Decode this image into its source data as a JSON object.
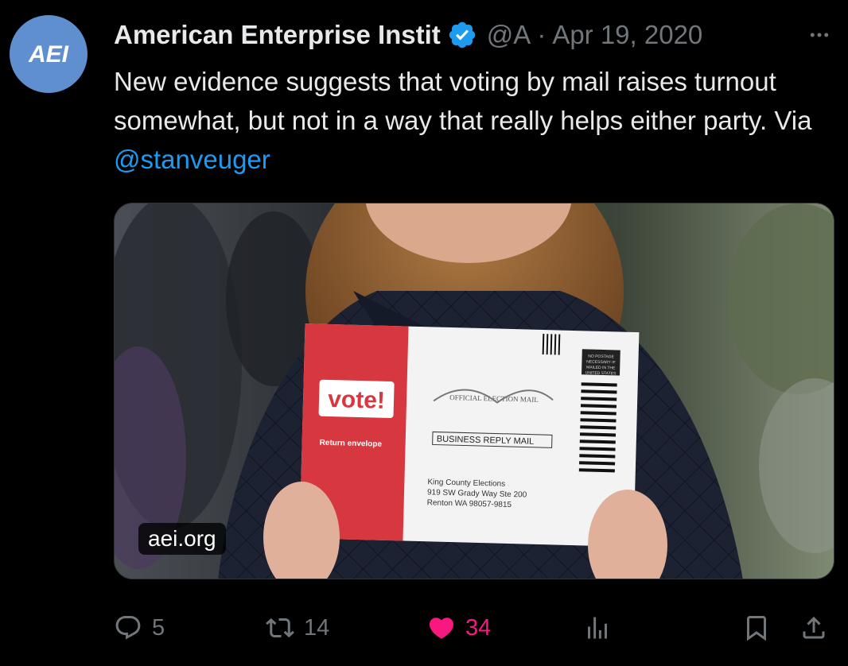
{
  "account": {
    "display_name": "American Enterprise Instit",
    "handle": "@A",
    "date_separator": "·",
    "date": "Apr 19, 2020",
    "avatar_logo_text": "AEI",
    "verified": true
  },
  "tweet": {
    "text_before": "New evidence suggests that voting by mail raises turnout somewhat, but not in a way that really helps either party. Via ",
    "mention": "@stanveuger"
  },
  "media": {
    "source_label": "aei.org",
    "envelope": {
      "vote_label": "vote!",
      "return_label": "Return envelope",
      "official_label": "OFFICIAL ELECTION MAIL",
      "business_label": "BUSINESS REPLY MAIL",
      "address_lines": [
        "King County Elections",
        "919 SW Grady Way Ste 200",
        "Renton WA 98057-9815"
      ],
      "postage_lines": [
        "NO POSTAGE",
        "NECESSARY IF",
        "MAILED IN THE",
        "UNITED STATES"
      ]
    }
  },
  "actions": {
    "reply_count": "5",
    "retweet_count": "14",
    "like_count": "34",
    "liked": true
  },
  "icons": {
    "more": "more-icon",
    "reply": "reply-icon",
    "retweet": "retweet-icon",
    "like": "heart-icon",
    "views": "analytics-icon",
    "bookmark": "bookmark-icon",
    "share": "share-icon"
  },
  "colors": {
    "background": "#000000",
    "text": "#e7e9ea",
    "muted": "#71767b",
    "link": "#1d9bf0",
    "like": "#f91880",
    "avatar": "#5f8fcf",
    "verified": "#1d9bf0"
  }
}
